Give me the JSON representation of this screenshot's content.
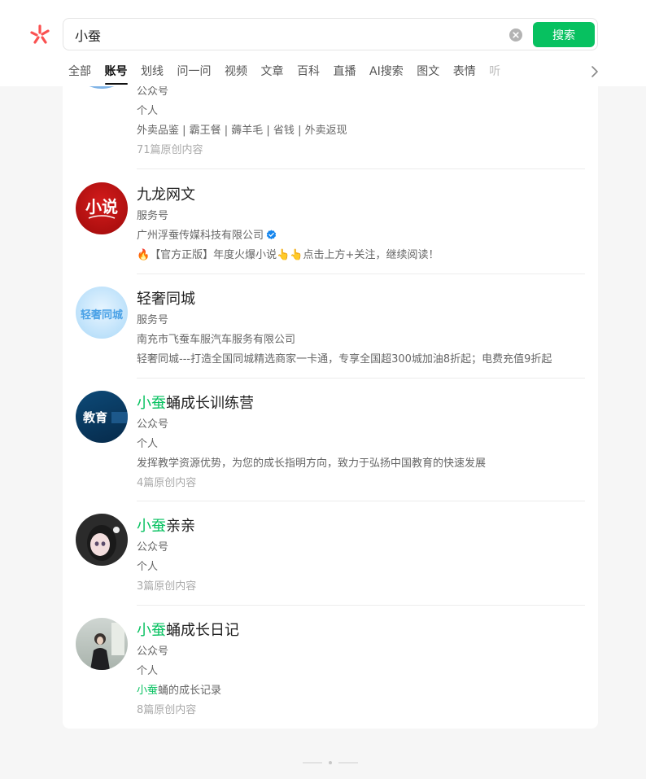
{
  "search": {
    "query": "小蚕",
    "button_label": "搜索"
  },
  "tabs": [
    {
      "label": "全部"
    },
    {
      "label": "账号"
    },
    {
      "label": "划线"
    },
    {
      "label": "问一问"
    },
    {
      "label": "视频"
    },
    {
      "label": "文章"
    },
    {
      "label": "百科"
    },
    {
      "label": "直播"
    },
    {
      "label": "AI搜索"
    },
    {
      "label": "图文"
    },
    {
      "label": "表情"
    },
    {
      "label": "听"
    }
  ],
  "active_tab": "账号",
  "results": [
    {
      "name_rest": "",
      "type": "公众号",
      "subject": "个人",
      "description": "外卖品鉴 | 霸王餐 | 薅羊毛 | 省钱 | 外卖返现",
      "articles": "71篇原创内容"
    },
    {
      "name_rest": "九龙网文",
      "type": "服务号",
      "company": "广州浮蚕传媒科技有限公司",
      "description": "🔥【官方正版】年度火爆小说👆👆点击上方+关注，继续阅读！",
      "avatar_text": "小说"
    },
    {
      "name_rest": "轻奢同城",
      "type": "服务号",
      "company": "南充市飞蚕车服汽车服务有限公司",
      "description": "轻奢同城---打造全国同城精选商家一卡通，专享全国超300城加油8折起；电费充值9折起",
      "avatar_text": "轻奢同城"
    },
    {
      "name_hl": "小蚕",
      "name_rest": "蛹成长训练营",
      "type": "公众号",
      "subject": "个人",
      "description": "发挥教学资源优势，为您的成长指明方向，致力于弘扬中国教育的快速发展",
      "articles": "4篇原创内容",
      "avatar_text": "教育"
    },
    {
      "name_hl": "小蚕",
      "name_rest": "亲亲",
      "type": "公众号",
      "subject": "个人",
      "articles": "3篇原创内容"
    },
    {
      "name_hl": "小蚕",
      "name_rest": "蛹成长日记",
      "type": "公众号",
      "subject": "个人",
      "desc_hl": "小蚕",
      "desc_rest": "蛹的成长记录",
      "articles": "8篇原创内容"
    }
  ],
  "colors": {
    "accent": "#07c160",
    "logo": "#fa5151",
    "verified": "#1485ee"
  }
}
